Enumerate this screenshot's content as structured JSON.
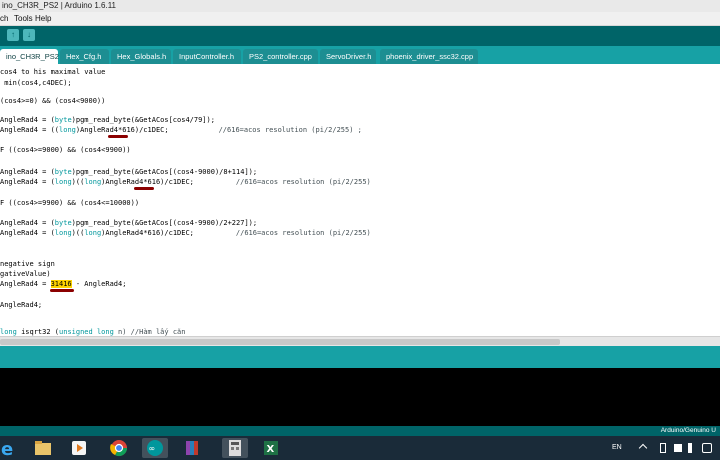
{
  "window": {
    "title": "ino_CH3R_PS2 | Arduino 1.6.11"
  },
  "menu": {
    "items": [
      "ch",
      "Tools",
      "Help"
    ]
  },
  "toolbar": {
    "buttons": [
      "upload-icon",
      "save-icon"
    ]
  },
  "tabs": [
    {
      "label": "ino_CH3R_PS2",
      "active": true
    },
    {
      "label": "Hex_Cfg.h"
    },
    {
      "label": "Hex_Globals.h"
    },
    {
      "label": "InputController.h"
    },
    {
      "label": "PS2_controller.cpp"
    },
    {
      "label": "ServoDriver.h"
    },
    {
      "label": "phoenix_driver_ssc32.cpp"
    }
  ],
  "code": {
    "l1": "cos4 to his maximal value",
    "l2a": "min(cos4,c4DEC);",
    "l3": "(cos4>=0) && (cos4<9000))",
    "l4a": "AngleRad4 = ",
    "l4b": "byte",
    "l4c": ")pgm_read_byte(&GetACos[cos4/79]);",
    "l5a": "AngleRad4 = ((",
    "l5b": "long",
    "l5c": ")AngleRad4*616)/c1DEC;",
    "l5d": "//616=acos resolution (pi/2/255) ;",
    "l6": "F ((cos4>=9000) && (cos4<9900))",
    "l7a": "AngleRad4 = (",
    "l7b": "byte",
    "l7c": ")pgm_read_byte(&GetACos[(cos4-9000)/8+114]);",
    "l8a": "AngleRad4 = (",
    "l8b": "long",
    "l8c": ")((",
    "l8d": "long",
    "l8e": ")AngleRad4*616)/c1DEC;",
    "l8f": "//616=acos resolution (pi/2/255)",
    "l9": "F ((cos4>=9900) && (cos4<=10000))",
    "l10a": "AngleRad4 = (",
    "l10b": "byte",
    "l10c": ")pgm_read_byte(&GetACos[(cos4-9900)/2+227]);",
    "l11a": "AngleRad4 = (",
    "l11b": "long",
    "l11c": ")((",
    "l11d": "long",
    "l11e": ")AngleRad4*616)/c1DEC;",
    "l11f": "//616=acos resolution (pi/2/255)",
    "l12": "negative sign",
    "l13": "gativeValue)",
    "l14a": "AngleRad4 = ",
    "l14b": "31416",
    "l14c": " - AngleRad4;",
    "l15": "AngleRad4;",
    "l16a": "long",
    "l16b": " isqrt32 (",
    "l16c": "unsigned long",
    "l16d": " n) //Hàm lấy căn"
  },
  "footer": {
    "board": "Arduino/Genuino U"
  },
  "taskbar": {
    "apps": [
      "ie-icon",
      "file-explorer-icon",
      "media-player-icon",
      "chrome-icon",
      "arduino-icon",
      "winrar-icon",
      "calculator-icon",
      "excel-icon"
    ],
    "language": "EN"
  }
}
